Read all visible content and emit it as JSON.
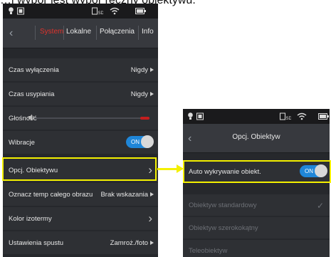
{
  "caption": "…i wybór jest wybór ręczny obiektywu.",
  "screen1": {
    "tabs": [
      "System",
      "Lokalne",
      "Połączenia",
      "Info"
    ],
    "rows": [
      {
        "label": "Czas wyłączenia",
        "value": "Nigdy"
      },
      {
        "label": "Czas usypiania",
        "value": "Nigdy"
      },
      {
        "label": "Głośność"
      },
      {
        "label": "Wibracje",
        "toggle": "ON"
      },
      {
        "label": "Opcj. Obiektywu"
      },
      {
        "label": "Oznacz temp całego obrazu",
        "value": "Brak wskazania"
      },
      {
        "label": "Kolor izotermy"
      },
      {
        "label": "Ustawienia spustu",
        "value": "Zamroż./foto"
      }
    ],
    "volume_level": 0.08
  },
  "screen2": {
    "title": "Opcj. Obiektyw",
    "auto_label": "Auto wykrywanie obiekt.",
    "auto_toggle": "ON",
    "options": [
      "Obiektyw standardowy",
      "Obiektyw szerokokątny",
      "Teleobiektyw"
    ]
  },
  "colors": {
    "accent_red": "#e0322c",
    "toggle_blue": "#1f86d8",
    "highlight": "#f4f000"
  }
}
